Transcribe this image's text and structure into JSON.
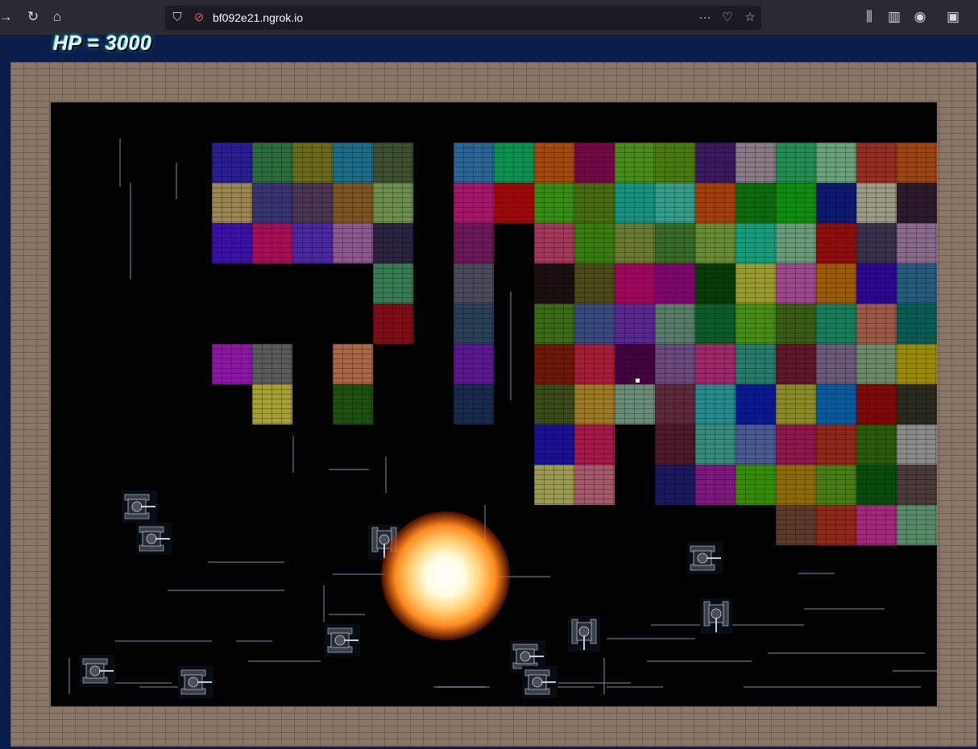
{
  "browser": {
    "url": "bf092e21.ngrok.io",
    "icons": [
      "forward-icon",
      "reload-icon",
      "home-icon",
      "shield-icon",
      "site-icon",
      "more-icon",
      "pocket-icon",
      "star-icon",
      "library-icon",
      "sidebar-icon",
      "account-icon",
      "extensions-icon"
    ]
  },
  "hud": {
    "hp_text": "HP = 3000"
  },
  "game": {
    "grid_cell": 50,
    "bricks": [
      [
        200,
        50,
        "#2a1f8c"
      ],
      [
        250,
        50,
        "#2f6b3d"
      ],
      [
        300,
        50,
        "#6a6a1e"
      ],
      [
        350,
        50,
        "#1f6a85"
      ],
      [
        400,
        50,
        "#3d4f2e"
      ],
      [
        200,
        100,
        "#9a8555"
      ],
      [
        250,
        100,
        "#38346e"
      ],
      [
        300,
        100,
        "#4a3650"
      ],
      [
        350,
        100,
        "#7a5525"
      ],
      [
        400,
        100,
        "#6f8d50"
      ],
      [
        200,
        150,
        "#3a12a0"
      ],
      [
        250,
        150,
        "#a01255"
      ],
      [
        300,
        150,
        "#4a2a9a"
      ],
      [
        350,
        150,
        "#8a5a8a"
      ],
      [
        400,
        150,
        "#2a2440"
      ],
      [
        400,
        200,
        "#3a7a55"
      ],
      [
        400,
        250,
        "#7a0f18"
      ],
      [
        200,
        300,
        "#8a1aa0"
      ],
      [
        250,
        300,
        "#5a5a5a"
      ],
      [
        350,
        300,
        "#a5684a"
      ],
      [
        250,
        350,
        "#a5a03a"
      ],
      [
        350,
        350,
        "#1f5012"
      ],
      [
        500,
        50,
        "#2e6590"
      ],
      [
        550,
        50,
        "#0f9050"
      ],
      [
        600,
        50,
        "#a04a12"
      ],
      [
        650,
        50,
        "#700a45"
      ],
      [
        700,
        50,
        "#4a8a1e"
      ],
      [
        750,
        50,
        "#4a7a0f"
      ],
      [
        800,
        50,
        "#3a1a5a"
      ],
      [
        850,
        50,
        "#8a7a85"
      ],
      [
        900,
        50,
        "#2a8a55"
      ],
      [
        950,
        50,
        "#6aa07a"
      ],
      [
        1000,
        50,
        "#903025"
      ],
      [
        1050,
        50,
        "#9a4515"
      ],
      [
        500,
        100,
        "#a01a6a"
      ],
      [
        550,
        100,
        "#9a0a0a"
      ],
      [
        600,
        100,
        "#3a8a1a"
      ],
      [
        650,
        100,
        "#4a6a12"
      ],
      [
        700,
        100,
        "#1a9080"
      ],
      [
        750,
        100,
        "#3a9a8a"
      ],
      [
        800,
        100,
        "#a0400a"
      ],
      [
        850,
        100,
        "#0f6a0f"
      ],
      [
        900,
        100,
        "#128a12"
      ],
      [
        950,
        100,
        "#0f1a6a"
      ],
      [
        1000,
        100,
        "#9a9a85"
      ],
      [
        1050,
        100,
        "#2a1a2a"
      ],
      [
        500,
        150,
        "#6a1a55"
      ],
      [
        600,
        150,
        "#a03a5a"
      ],
      [
        650,
        150,
        "#3a7a12"
      ],
      [
        700,
        150,
        "#6a7a35"
      ],
      [
        750,
        150,
        "#3a6a2a"
      ],
      [
        800,
        150,
        "#6a8a3a"
      ],
      [
        850,
        150,
        "#1a9a7a"
      ],
      [
        900,
        150,
        "#6a9a7a"
      ],
      [
        950,
        150,
        "#8a0f0f"
      ],
      [
        1000,
        150,
        "#3a304a"
      ],
      [
        1050,
        150,
        "#8a6a8a"
      ],
      [
        500,
        200,
        "#4a4a5a"
      ],
      [
        600,
        200,
        "#1a1010"
      ],
      [
        650,
        200,
        "#4a4a1a"
      ],
      [
        700,
        200,
        "#9a0a5a"
      ],
      [
        750,
        200,
        "#7a0a6a"
      ],
      [
        800,
        200,
        "#0a3a0a"
      ],
      [
        850,
        200,
        "#9a9a35"
      ],
      [
        900,
        200,
        "#9a4a8a"
      ],
      [
        950,
        200,
        "#9a5a0a"
      ],
      [
        1000,
        200,
        "#2a0a8a"
      ],
      [
        1050,
        200,
        "#2a5a7a"
      ],
      [
        500,
        250,
        "#2a4055"
      ],
      [
        600,
        250,
        "#3a6a1a"
      ],
      [
        650,
        250,
        "#3a4a7a"
      ],
      [
        700,
        250,
        "#5a2a8a"
      ],
      [
        750,
        250,
        "#5a7a6a"
      ],
      [
        800,
        250,
        "#0f5a2a"
      ],
      [
        850,
        250,
        "#4a8a1a"
      ],
      [
        900,
        250,
        "#3a5a1a"
      ],
      [
        950,
        250,
        "#1a7a5a"
      ],
      [
        1000,
        250,
        "#9a5a4a"
      ],
      [
        1050,
        250,
        "#0a5a55"
      ],
      [
        500,
        300,
        "#5a1a8a"
      ],
      [
        600,
        300,
        "#6a1a0a"
      ],
      [
        650,
        300,
        "#a0203a"
      ],
      [
        700,
        300,
        "#40053a"
      ],
      [
        750,
        300,
        "#6a4a7a"
      ],
      [
        800,
        300,
        "#9a2a6a"
      ],
      [
        850,
        300,
        "#2a7a6a"
      ],
      [
        900,
        300,
        "#5a1a2a"
      ],
      [
        950,
        300,
        "#6a5a7a"
      ],
      [
        1000,
        300,
        "#6a8a6a"
      ],
      [
        1050,
        300,
        "#9a8a0a"
      ],
      [
        500,
        350,
        "#1a2a4a"
      ],
      [
        600,
        350,
        "#3a4a1a"
      ],
      [
        650,
        350,
        "#9a7a2a"
      ],
      [
        700,
        350,
        "#6a8a7a"
      ],
      [
        750,
        350,
        "#5a2a3a"
      ],
      [
        800,
        350,
        "#2a8a8a"
      ],
      [
        850,
        350,
        "#0a1a8a"
      ],
      [
        900,
        350,
        "#8a8a2a"
      ],
      [
        950,
        350,
        "#0a5a9a"
      ],
      [
        1000,
        350,
        "#7a0a0a"
      ],
      [
        1050,
        350,
        "#2a2a20"
      ],
      [
        600,
        400,
        "#1a128a"
      ],
      [
        650,
        400,
        "#a01a4a"
      ],
      [
        750,
        400,
        "#4a1a2a"
      ],
      [
        800,
        400,
        "#3a8a7a"
      ],
      [
        850,
        400,
        "#4a5a8a"
      ],
      [
        900,
        400,
        "#8a1a4a"
      ],
      [
        950,
        400,
        "#8a2a1a"
      ],
      [
        1000,
        400,
        "#2a5a0a"
      ],
      [
        1050,
        400,
        "#8a8a8a"
      ],
      [
        600,
        450,
        "#9a9a55"
      ],
      [
        650,
        450,
        "#a05a6a"
      ],
      [
        750,
        450,
        "#1a1a5a"
      ],
      [
        800,
        450,
        "#7a1a7a"
      ],
      [
        850,
        450,
        "#3a8a0a"
      ],
      [
        900,
        450,
        "#8a6a0a"
      ],
      [
        950,
        450,
        "#4a7a1a"
      ],
      [
        1000,
        450,
        "#0a4a0a"
      ],
      [
        1050,
        450,
        "#4a3a3a"
      ],
      [
        900,
        500,
        "#5a3a2a"
      ],
      [
        950,
        500,
        "#8a2a1a"
      ],
      [
        1000,
        500,
        "#a02a7a"
      ],
      [
        1050,
        500,
        "#5a8a6a"
      ]
    ]
  }
}
